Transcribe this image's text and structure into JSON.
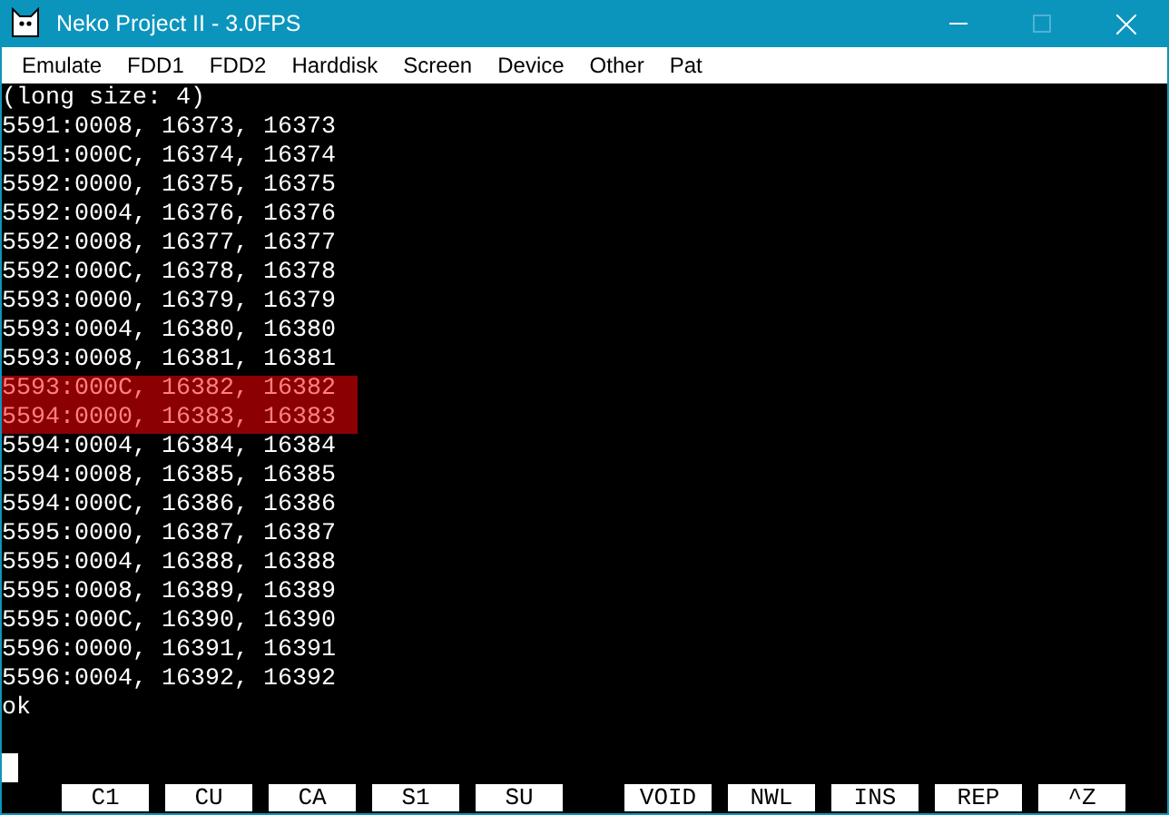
{
  "window": {
    "title": "Neko Project II - 3.0FPS",
    "maximize_disabled": true
  },
  "menu": [
    "Emulate",
    "FDD1",
    "FDD2",
    "Harddisk",
    "Screen",
    "Device",
    "Other",
    "Pat"
  ],
  "console_lines": [
    {
      "text": "(long size: 4)",
      "selected": false
    },
    {
      "text": "5591:0008, 16373, 16373",
      "selected": false
    },
    {
      "text": "5591:000C, 16374, 16374",
      "selected": false
    },
    {
      "text": "5592:0000, 16375, 16375",
      "selected": false
    },
    {
      "text": "5592:0004, 16376, 16376",
      "selected": false
    },
    {
      "text": "5592:0008, 16377, 16377",
      "selected": false
    },
    {
      "text": "5592:000C, 16378, 16378",
      "selected": false
    },
    {
      "text": "5593:0000, 16379, 16379",
      "selected": false
    },
    {
      "text": "5593:0004, 16380, 16380",
      "selected": false
    },
    {
      "text": "5593:0008, 16381, 16381",
      "selected": false
    },
    {
      "text": "5593:000C, 16382, 16382",
      "selected": true
    },
    {
      "text": "5594:0000, 16383, 16383",
      "selected": true
    },
    {
      "text": "5594:0004, 16384, 16384",
      "selected": false
    },
    {
      "text": "5594:0008, 16385, 16385",
      "selected": false
    },
    {
      "text": "5594:000C, 16386, 16386",
      "selected": false
    },
    {
      "text": "5595:0000, 16387, 16387",
      "selected": false
    },
    {
      "text": "5595:0004, 16388, 16388",
      "selected": false
    },
    {
      "text": "5595:0008, 16389, 16389",
      "selected": false
    },
    {
      "text": "5595:000C, 16390, 16390",
      "selected": false
    },
    {
      "text": "5596:0000, 16391, 16391",
      "selected": false
    },
    {
      "text": "5596:0004, 16392, 16392",
      "selected": false
    },
    {
      "text": "ok",
      "selected": false
    }
  ],
  "function_keys": [
    [
      "C1",
      "CU",
      "CA",
      "S1",
      "SU"
    ],
    [
      "VOID",
      "NWL",
      "INS",
      "REP",
      "^Z"
    ]
  ]
}
